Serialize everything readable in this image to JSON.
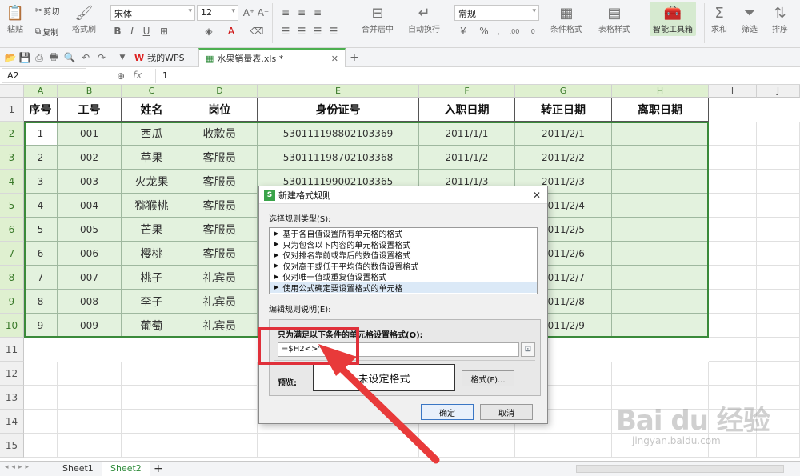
{
  "ribbon": {
    "paste": "粘贴",
    "cut": "剪切",
    "copy": "复制",
    "format_painter": "格式刷",
    "font_name": "宋体",
    "font_size": "12",
    "merge_center": "合并居中",
    "wrap": "自动换行",
    "number_format": "常规",
    "conditional_format": "条件格式",
    "table_style": "表格样式",
    "smart_toolbox": "智能工具箱",
    "sum": "求和",
    "filter": "筛选",
    "sort": "排序"
  },
  "tabs": {
    "my_wps": "我的WPS",
    "file": "水果销量表.xls *"
  },
  "formula": {
    "name_box": "A2",
    "fx": "fx",
    "value": "1"
  },
  "columns": [
    "A",
    "B",
    "C",
    "D",
    "E",
    "F",
    "G",
    "H",
    "I",
    "J"
  ],
  "rows": [
    "1",
    "2",
    "3",
    "4",
    "5",
    "6",
    "7",
    "8",
    "9",
    "10",
    "11",
    "12",
    "13",
    "14",
    "15"
  ],
  "headers": [
    "序号",
    "工号",
    "姓名",
    "岗位",
    "身份证号",
    "入职日期",
    "转正日期",
    "离职日期"
  ],
  "data_rows": [
    [
      "1",
      "001",
      "西瓜",
      "收款员",
      "530111198802103369",
      "2011/1/1",
      "2011/2/1",
      ""
    ],
    [
      "2",
      "002",
      "苹果",
      "客服员",
      "530111198702103368",
      "2011/1/2",
      "2011/2/2",
      ""
    ],
    [
      "3",
      "003",
      "火龙果",
      "客服员",
      "530111199002103365",
      "2011/1/3",
      "2011/2/3",
      ""
    ],
    [
      "4",
      "004",
      "猕猴桃",
      "客服员",
      "",
      "",
      "2011/2/4",
      ""
    ],
    [
      "5",
      "005",
      "芒果",
      "客服员",
      "",
      "",
      "2011/2/5",
      ""
    ],
    [
      "6",
      "006",
      "樱桃",
      "客服员",
      "",
      "",
      "2011/2/6",
      ""
    ],
    [
      "7",
      "007",
      "桃子",
      "礼宾员",
      "",
      "",
      "2011/2/7",
      ""
    ],
    [
      "8",
      "008",
      "李子",
      "礼宾员",
      "",
      "",
      "2011/2/8",
      ""
    ],
    [
      "9",
      "009",
      "葡萄",
      "礼宾员",
      "",
      "",
      "2011/2/9",
      ""
    ]
  ],
  "sheets": {
    "sheet1": "Sheet1",
    "sheet2": "Sheet2",
    "add": "+"
  },
  "dialog": {
    "title": "新建格式规则",
    "select_type": "选择规则类型(S):",
    "rule_types": [
      "基于各自值设置所有单元格的格式",
      "只为包含以下内容的单元格设置格式",
      "仅对排名靠前或靠后的数值设置格式",
      "仅对高于或低于平均值的数值设置格式",
      "仅对唯一值或重复值设置格式",
      "使用公式确定要设置格式的单元格"
    ],
    "edit_desc": "编辑规则说明(E):",
    "formula_label": "只为满足以下条件的单元格设置格式(O):",
    "formula_value": "=$H2<>\"\"",
    "preview_label": "预览:",
    "preview_text": "未设定格式",
    "format_button": "格式(F)...",
    "ok": "确定",
    "cancel": "取消"
  },
  "watermark": {
    "brand": "Bai du 经验",
    "url": "jingyan.baidu.com"
  },
  "colors": {
    "selection_fill": "#e3f2de",
    "highlight_red": "#e0303a",
    "accent_green": "#3a7a2a"
  }
}
